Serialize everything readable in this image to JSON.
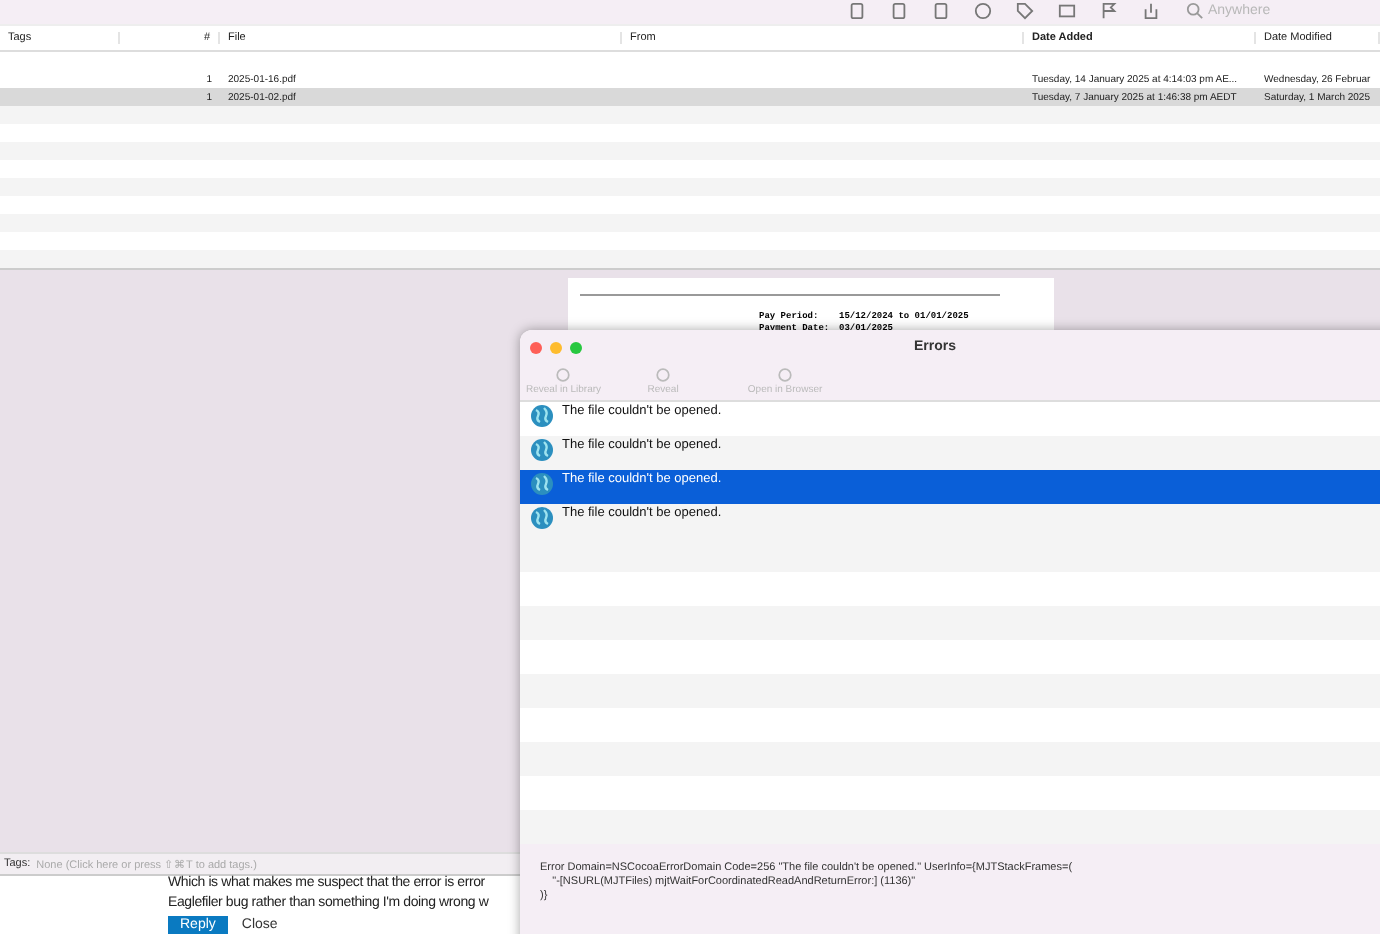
{
  "library_window": {
    "search": {
      "placeholder": "Anywhere"
    },
    "columns": [
      {
        "label": "Tags",
        "sorted": false
      },
      {
        "label": "#",
        "sorted": false
      },
      {
        "label": "File",
        "sorted": false
      },
      {
        "label": "From",
        "sorted": false
      },
      {
        "label": "Date Added",
        "sorted": true
      },
      {
        "label": "Date Modified",
        "sorted": false
      }
    ],
    "rows": [
      {
        "count": "1",
        "file": "2025-01-16.pdf",
        "date_added": "Tuesday, 14 January 2025 at 4:14:03 pm AE...",
        "date_modified": "Wednesday, 26 Februar",
        "selected": false
      },
      {
        "count": "1",
        "file": "2025-01-02.pdf",
        "date_added": "Tuesday, 7 January 2025 at 1:46:38 pm AEDT",
        "date_modified": "Saturday, 1 March 2025",
        "selected": true
      }
    ],
    "preview": {
      "lines": [
        {
          "label": "Pay Period:",
          "value": "15/12/2024 to 01/01/2025"
        },
        {
          "label": "Payment Date:",
          "value": "03/01/2025"
        }
      ]
    },
    "tags_bar": {
      "label": "Tags:",
      "hint": "None (Click here or press ⇧⌘T to add tags.)"
    }
  },
  "forum": {
    "lines": [
      "Which is what makes me suspect that the error is error",
      "Eaglefiler bug rather than something I'm doing wrong w"
    ],
    "reply_button": "Reply",
    "close_link": "Close"
  },
  "errors_window": {
    "title": "Errors",
    "toolbar": [
      {
        "label": "Reveal in Library",
        "disabled": true
      },
      {
        "label": "Reveal",
        "disabled": true
      },
      {
        "label": "Open in Browser",
        "disabled": true
      }
    ],
    "errors": [
      {
        "message": "The file couldn't be opened.",
        "selected": false
      },
      {
        "message": "The file couldn't be opened.",
        "selected": false
      },
      {
        "message": "The file couldn't be opened.",
        "selected": true
      },
      {
        "message": "The file couldn't be opened.",
        "selected": false
      }
    ],
    "detail": [
      "Error Domain=NSCocoaErrorDomain Code=256 \"The file couldn't be opened.\" UserInfo={MJTStackFrames=(",
      "    \"-[NSURL(MJTFiles) mjtWaitForCoordinatedReadAndReturnError:] (1136)\"",
      ")}"
    ]
  }
}
